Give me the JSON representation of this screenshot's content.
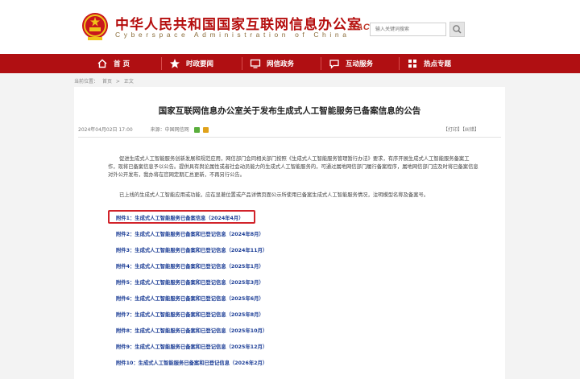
{
  "header": {
    "title": "中华人民共和国国家互联网信息办公室",
    "subtitle": "Cyberspace Administration of China",
    "cac_logo_text": "CAC",
    "search_placeholder": "输入关键词搜索"
  },
  "nav": {
    "items": [
      {
        "label": "首 页",
        "icon": "home-icon"
      },
      {
        "label": "时政要闻",
        "icon": "star-icon"
      },
      {
        "label": "网信政务",
        "icon": "monitor-icon"
      },
      {
        "label": "互动服务",
        "icon": "chat-icon"
      },
      {
        "label": "热点专题",
        "icon": "grid-icon"
      }
    ]
  },
  "breadcrumb": [
    "当前位置：",
    "首页",
    ">",
    "正文"
  ],
  "article": {
    "title": "国家互联网信息办公室关于发布生成式人工智能服务已备案信息的公告",
    "date": "2024年04月02日 17:00",
    "source": "来源：中国网信网",
    "tools": "【打印】【纠错】",
    "paragraph1": "促进生成式人工智能服务创新发展和规范应用，网信部门会同相关部门按照《生成式人工智能服务管理暂行办法》要求，有序开展生成式人工智能服务备案工作，现将已备案信息予以公告。提供具有舆论属性或者社会动员能力的生成式人工智能服务的，可通过属地网信部门履行备案程序，属地网信部门应及时将已备案信息对外公开发布，我办将在官网定期汇总更新，不再另行公告。",
    "paragraph2": "已上线的生成式人工智能应用或功能，应在显著位置或产品详情页面公示所使用已备案生成式人工智能服务情况，注明模型名称及备案号。",
    "attachments": [
      "附件1：生成式人工智能服务已备案信息（2024年4月）",
      "附件2：生成式人工智能服务已备案和已登记信息（2024年8月）",
      "附件3：生成式人工智能服务已备案和已登记信息（2024年11月）",
      "附件4：生成式人工智能服务已备案和已登记信息（2025年1月）",
      "附件5：生成式人工智能服务已备案和已登记信息（2025年3月）",
      "附件6：生成式人工智能服务已备案和已登记信息（2025年6月）",
      "附件7：生成式人工智能服务已备案和已登记信息（2025年8月）",
      "附件8：生成式人工智能服务已备案和已登记信息（2025年10月）",
      "附件9：生成式人工智能服务已备案和已登记信息（2025年12月）",
      "附件10：生成式人工智能服务已备案和已登记信息（2026年2月）"
    ]
  },
  "colors": {
    "brand_red": "#b00f12",
    "link_blue": "#1b3d96",
    "highlight_red": "#d1232a"
  }
}
